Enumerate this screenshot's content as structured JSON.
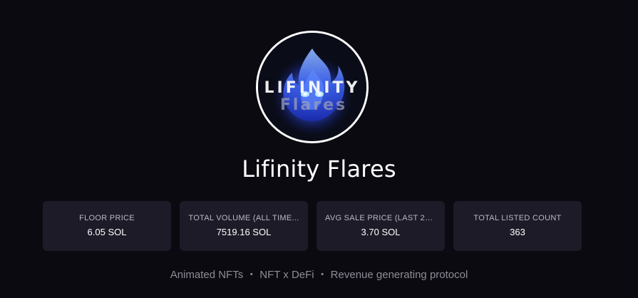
{
  "collection": {
    "name": "Lifinity Flares",
    "logo": {
      "text_line1": "LIFINITY",
      "text_line2": "Flares",
      "icon": "blue-flame-logo-icon"
    }
  },
  "stats": [
    {
      "label": "FLOOR PRICE",
      "value": "6.05 SOL"
    },
    {
      "label": "TOTAL VOLUME (ALL TIME...",
      "value": "7519.16 SOL"
    },
    {
      "label": "AVG SALE PRICE (LAST 24...",
      "value": "3.70 SOL"
    },
    {
      "label": "TOTAL LISTED COUNT",
      "value": "363"
    }
  ],
  "tags": {
    "items": [
      "Animated NFTs",
      "NFT x DeFi",
      "Revenue generating protocol"
    ],
    "separator": "・"
  },
  "colors": {
    "background": "#0b0a10",
    "card": "#1c1b27",
    "flame_blue": "#3a6cff",
    "flame_glow": "#7fb2ff"
  }
}
